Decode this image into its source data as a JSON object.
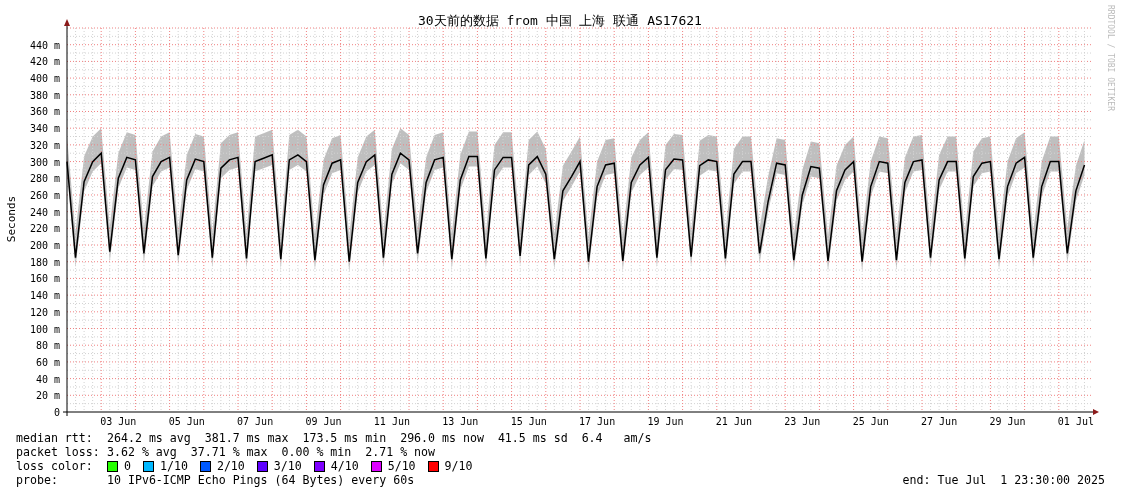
{
  "title": "30天前的数据 from 中国 上海 联通 AS17621",
  "chart": {
    "chart_data": {
      "type": "line",
      "ylabel": "Seconds",
      "categories": [
        null,
        null,
        null,
        null,
        null,
        null,
        "03 Jun",
        null,
        null,
        null,
        null,
        null,
        null,
        null,
        "05 Jun",
        null,
        null,
        null,
        null,
        null,
        null,
        null,
        "07 Jun",
        null,
        null,
        null,
        null,
        null,
        null,
        null,
        "09 Jun",
        null,
        null,
        null,
        null,
        null,
        null,
        null,
        "11 Jun",
        null,
        null,
        null,
        null,
        null,
        null,
        null,
        "13 Jun",
        null,
        null,
        null,
        null,
        null,
        null,
        null,
        "15 Jun",
        null,
        null,
        null,
        null,
        null,
        null,
        null,
        "17 Jun",
        null,
        null,
        null,
        null,
        null,
        null,
        null,
        "19 Jun",
        null,
        null,
        null,
        null,
        null,
        null,
        null,
        "21 Jun",
        null,
        null,
        null,
        null,
        null,
        null,
        null,
        "23 Jun",
        null,
        null,
        null,
        null,
        null,
        null,
        null,
        "25 Jun",
        null,
        null,
        null,
        null,
        null,
        null,
        null,
        "27 Jun",
        null,
        null,
        null,
        null,
        null,
        null,
        null,
        "29 Jun",
        null,
        null,
        null,
        null,
        null,
        null,
        null,
        "01 Jul",
        null
      ],
      "series": [
        {
          "color": "#000000",
          "values": [
            300,
            185,
            276,
            300,
            310,
            192,
            280,
            305,
            302,
            190,
            282,
            300,
            305,
            188,
            278,
            303,
            300,
            185,
            292,
            302,
            305,
            184,
            300,
            304,
            308,
            183,
            302,
            308,
            300,
            182,
            272,
            298,
            302,
            180,
            275,
            300,
            308,
            185,
            285,
            310,
            302,
            190,
            275,
            302,
            305,
            183,
            278,
            306,
            306,
            184,
            290,
            305,
            305,
            187,
            296,
            306,
            285,
            183,
            265,
            282,
            300,
            180,
            270,
            296,
            298,
            181,
            275,
            296,
            305,
            185,
            290,
            303,
            302,
            186,
            295,
            302,
            300,
            184,
            285,
            300,
            300,
            190,
            252,
            298,
            296,
            182,
            260,
            294,
            292,
            181,
            265,
            290,
            300,
            180,
            270,
            300,
            298,
            182,
            275,
            300,
            302,
            185,
            278,
            300,
            300,
            184,
            282,
            298,
            300,
            183,
            270,
            298,
            305,
            185,
            270,
            300,
            300,
            190,
            265,
            296
          ]
        }
      ],
      "ylim": [
        0,
        460
      ],
      "grid": true,
      "yticks": [
        {
          "value": 0,
          "label": "0"
        },
        {
          "value": 20,
          "label": "20 m"
        },
        {
          "value": 40,
          "label": "40 m"
        },
        {
          "value": 60,
          "label": "60 m"
        },
        {
          "value": 80,
          "label": "80 m"
        },
        {
          "value": 100,
          "label": "100 m"
        },
        {
          "value": 120,
          "label": "120 m"
        },
        {
          "value": 140,
          "label": "140 m"
        },
        {
          "value": 160,
          "label": "160 m"
        },
        {
          "value": 180,
          "label": "180 m"
        },
        {
          "value": 200,
          "label": "200 m"
        },
        {
          "value": 220,
          "label": "220 m"
        },
        {
          "value": 240,
          "label": "240 m"
        },
        {
          "value": 260,
          "label": "260 m"
        },
        {
          "value": 280,
          "label": "280 m"
        },
        {
          "value": 300,
          "label": "300 m"
        },
        {
          "value": 320,
          "label": "320 m"
        },
        {
          "value": 340,
          "label": "340 m"
        },
        {
          "value": 360,
          "label": "360 m"
        },
        {
          "value": 380,
          "label": "380 m"
        },
        {
          "value": 400,
          "label": "400 m"
        },
        {
          "value": 420,
          "label": "420 m"
        },
        {
          "value": 440,
          "label": "440 m"
        }
      ]
    }
  },
  "credit": "RRDTOOL / TOBI OETIKER",
  "median_rtt": {
    "label": "median rtt:",
    "text": "264.2 ms avg  381.7 ms max  173.5 ms min  296.0 ms now  41.5 ms sd  6.4   am/s"
  },
  "packet_loss": {
    "label": "packet loss:",
    "text": "3.62 % avg  37.71 % max  0.00 % min  2.71 % now"
  },
  "loss_color": {
    "label": "loss color:",
    "items": [
      {
        "label": "0",
        "color": "#26ff00"
      },
      {
        "label": "1/10",
        "color": "#00b8ff"
      },
      {
        "label": "2/10",
        "color": "#0059ff"
      },
      {
        "label": "3/10",
        "color": "#5e00ff"
      },
      {
        "label": "4/10",
        "color": "#7e00ff"
      },
      {
        "label": "5/10",
        "color": "#dd00ff"
      },
      {
        "label": "9/10",
        "color": "#ff0000"
      }
    ]
  },
  "probe": {
    "label": "probe:",
    "text": "10 IPv6-ICMP Echo Pings (64 Bytes) every 60s"
  },
  "end": "end: Tue Jul  1 23:30:00 2025"
}
